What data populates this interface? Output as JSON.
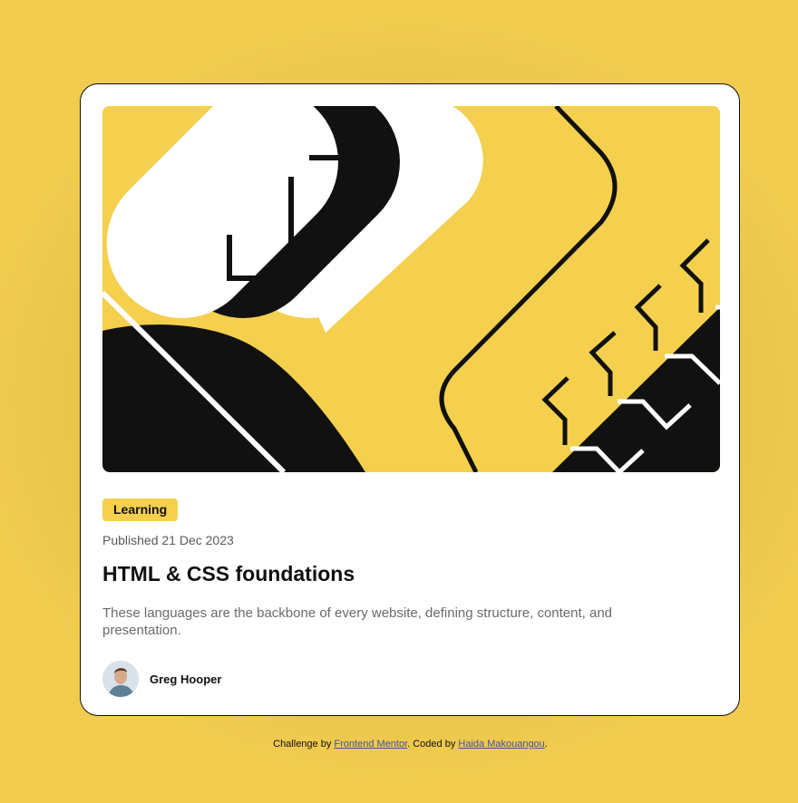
{
  "card": {
    "tag": "Learning",
    "published": "Published 21 Dec 2023",
    "title": "HTML & CSS foundations",
    "description": "These languages are the backbone of every website, defining structure, content, and presentation.",
    "author": {
      "name": "Greg Hooper"
    }
  },
  "attribution": {
    "prefix": "Challenge by ",
    "link1": "Frontend Mentor",
    "middle": ". Coded by ",
    "link2": "Haida Makouangou",
    "suffix": "."
  },
  "colors": {
    "accent": "#f4d04e",
    "background": "#f1cc4f",
    "text": "#111111",
    "muted": "#6b6b6b"
  }
}
